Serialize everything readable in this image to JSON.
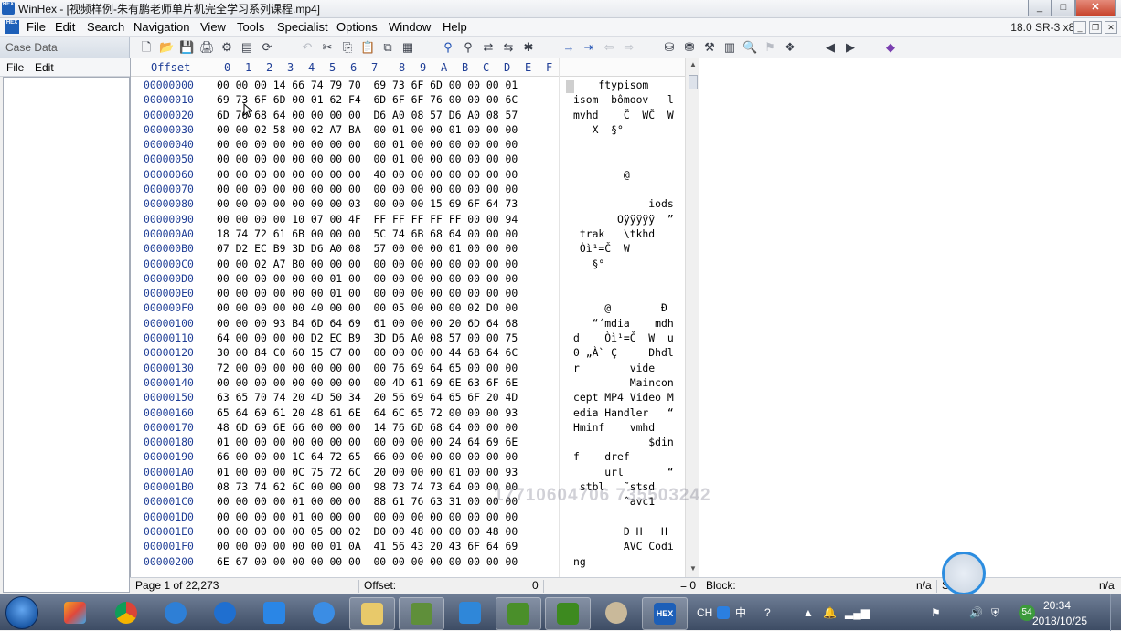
{
  "window": {
    "app_icon_text": "HEX",
    "title": "WinHex - [视频样例-朱有鹏老师单片机完全学习系列课程.mp4]",
    "minimize": "_",
    "maximize": "□",
    "close": "✕"
  },
  "menu": {
    "items": [
      "File",
      "Edit",
      "Search",
      "Navigation",
      "View",
      "Tools",
      "Specialist",
      "Options",
      "Window",
      "Help"
    ],
    "version": "18.0 SR-3 x86",
    "mdi_minimize": "_",
    "mdi_restore": "❐",
    "mdi_close": "✕"
  },
  "case_panel": {
    "title": "Case Data",
    "file": "File",
    "edit": "Edit"
  },
  "hex": {
    "offset_label": "Offset",
    "columns": [
      "0",
      "1",
      "2",
      "3",
      "4",
      "5",
      "6",
      "7",
      "8",
      "9",
      "A",
      "B",
      "C",
      "D",
      "E",
      "F"
    ],
    "rows": [
      {
        "offset": "00000000",
        "hex": "00 00 00 14 66 74 79 70  69 73 6F 6D 00 00 00 01",
        "ascii": "    ftypisom"
      },
      {
        "offset": "00000010",
        "hex": "69 73 6F 6D 00 01 62 F4  6D 6F 6F 76 00 00 00 6C",
        "ascii": "isom  bômoov   l"
      },
      {
        "offset": "00000020",
        "hex": "6D 76 68 64 00 00 00 00  D6 A0 08 57 D6 A0 08 57",
        "ascii": "mvhd    Č  WČ  W"
      },
      {
        "offset": "00000030",
        "hex": "00 00 02 58 00 02 A7 BA  00 01 00 00 01 00 00 00",
        "ascii": "   X  §°"
      },
      {
        "offset": "00000040",
        "hex": "00 00 00 00 00 00 00 00  00 01 00 00 00 00 00 00",
        "ascii": ""
      },
      {
        "offset": "00000050",
        "hex": "00 00 00 00 00 00 00 00  00 01 00 00 00 00 00 00",
        "ascii": ""
      },
      {
        "offset": "00000060",
        "hex": "00 00 00 00 00 00 00 00  40 00 00 00 00 00 00 00",
        "ascii": "        @"
      },
      {
        "offset": "00000070",
        "hex": "00 00 00 00 00 00 00 00  00 00 00 00 00 00 00 00",
        "ascii": ""
      },
      {
        "offset": "00000080",
        "hex": "00 00 00 00 00 00 00 03  00 00 00 15 69 6F 64 73",
        "ascii": "            iods"
      },
      {
        "offset": "00000090",
        "hex": "00 00 00 00 10 07 00 4F  FF FF FF FF FF 00 00 94",
        "ascii": "       Oÿÿÿÿÿ  ”"
      },
      {
        "offset": "000000A0",
        "hex": "18 74 72 61 6B 00 00 00  5C 74 6B 68 64 00 00 00",
        " ascii": "",
        "ascii": " trak   \\tkhd"
      },
      {
        "offset": "000000B0",
        "hex": "07 D2 EC B9 3D D6 A0 08  57 00 00 00 01 00 00 00",
        "ascii": " Òì¹=Č  W"
      },
      {
        "offset": "000000C0",
        "hex": "00 00 02 A7 B0 00 00 00  00 00 00 00 00 00 00 00",
        "ascii": "   §°"
      },
      {
        "offset": "000000D0",
        "hex": "00 00 00 00 00 00 01 00  00 00 00 00 00 00 00 00",
        "ascii": ""
      },
      {
        "offset": "000000E0",
        "hex": "00 00 00 00 00 00 01 00  00 00 00 00 00 00 00 00",
        "ascii": ""
      },
      {
        "offset": "000000F0",
        "hex": "00 00 00 00 00 40 00 00  00 05 00 00 00 02 D0 00",
        "ascii": "     @        Ð"
      },
      {
        "offset": "00000100",
        "hex": "00 00 00 93 B4 6D 64 69  61 00 00 00 20 6D 64 68",
        "ascii": "   “´mdia    mdh"
      },
      {
        "offset": "00000110",
        "hex": "64 00 00 00 00 D2 EC B9  3D D6 A0 08 57 00 00 75",
        "ascii": "d    Òì¹=Č  W  u"
      },
      {
        "offset": "00000120",
        "hex": "30 00 84 C0 60 15 C7 00  00 00 00 00 44 68 64 6C",
        "ascii": "0 „À` Ç     Dhdl"
      },
      {
        "offset": "00000130",
        "hex": "72 00 00 00 00 00 00 00  00 76 69 64 65 00 00 00",
        "ascii": "r        vide"
      },
      {
        "offset": "00000140",
        "hex": "00 00 00 00 00 00 00 00  00 4D 61 69 6E 63 6F 6E",
        "ascii": "         Maincon"
      },
      {
        "offset": "00000150",
        "hex": "63 65 70 74 20 4D 50 34  20 56 69 64 65 6F 20 4D",
        "ascii": "cept MP4 Video M"
      },
      {
        "offset": "00000160",
        "hex": "65 64 69 61 20 48 61 6E  64 6C 65 72 00 00 00 93",
        "ascii": "edia Handler   “"
      },
      {
        "offset": "00000170",
        "hex": "48 6D 69 6E 66 00 00 00  14 76 6D 68 64 00 00 00",
        "ascii": "Hminf    vmhd"
      },
      {
        "offset": "00000180",
        "hex": "01 00 00 00 00 00 00 00  00 00 00 00 24 64 69 6E",
        "ascii": "            $din"
      },
      {
        "offset": "00000190",
        "hex": "66 00 00 00 1C 64 72 65  66 00 00 00 00 00 00 00",
        "ascii": "f    dref"
      },
      {
        "offset": "000001A0",
        "hex": "01 00 00 00 0C 75 72 6C  20 00 00 00 01 00 00 93",
        "ascii": "     url       “"
      },
      {
        "offset": "000001B0",
        "hex": "08 73 74 62 6C 00 00 00  98 73 74 73 64 00 00 00",
        "ascii": " stbl   ˜stsd"
      },
      {
        "offset": "000001C0",
        "hex": "00 00 00 00 01 00 00 00  88 61 76 63 31 00 00 00",
        "ascii": "        ˆavc1"
      },
      {
        "offset": "000001D0",
        "hex": "00 00 00 00 01 00 00 00  00 00 00 00 00 00 00 00",
        "ascii": ""
      },
      {
        "offset": "000001E0",
        "hex": "00 00 00 00 00 05 00 02  D0 00 48 00 00 00 48 00",
        "ascii": "        Ð H   H"
      },
      {
        "offset": "000001F0",
        "hex": "00 00 00 00 00 00 01 0A  41 56 43 20 43 6F 64 69",
        "ascii": "        AVC Codi"
      },
      {
        "offset": "00000200",
        "hex": "6E 67 00 00 00 00 00 00  00 00 00 00 00 00 00 00",
        "ascii": "ng"
      }
    ]
  },
  "status": {
    "page": "Page 1 of 22,273",
    "offset_label": "Offset:",
    "offset_value": "0",
    "value": "= 0",
    "block_label": "Block:",
    "block_value": "n/a",
    "size_label": "Si",
    "size_value": "n/a"
  },
  "watermark": "17710604706 735503242",
  "taskbar": {
    "tray_lang": "CH",
    "tray_ime": "中",
    "clock_time": "20:34",
    "clock_date": "2018/10/25",
    "badge": "54"
  },
  "colors": {
    "offset_blue": "#1f3e96",
    "title_bar": "#e6e9ee",
    "taskbar": "#3d4c64"
  }
}
